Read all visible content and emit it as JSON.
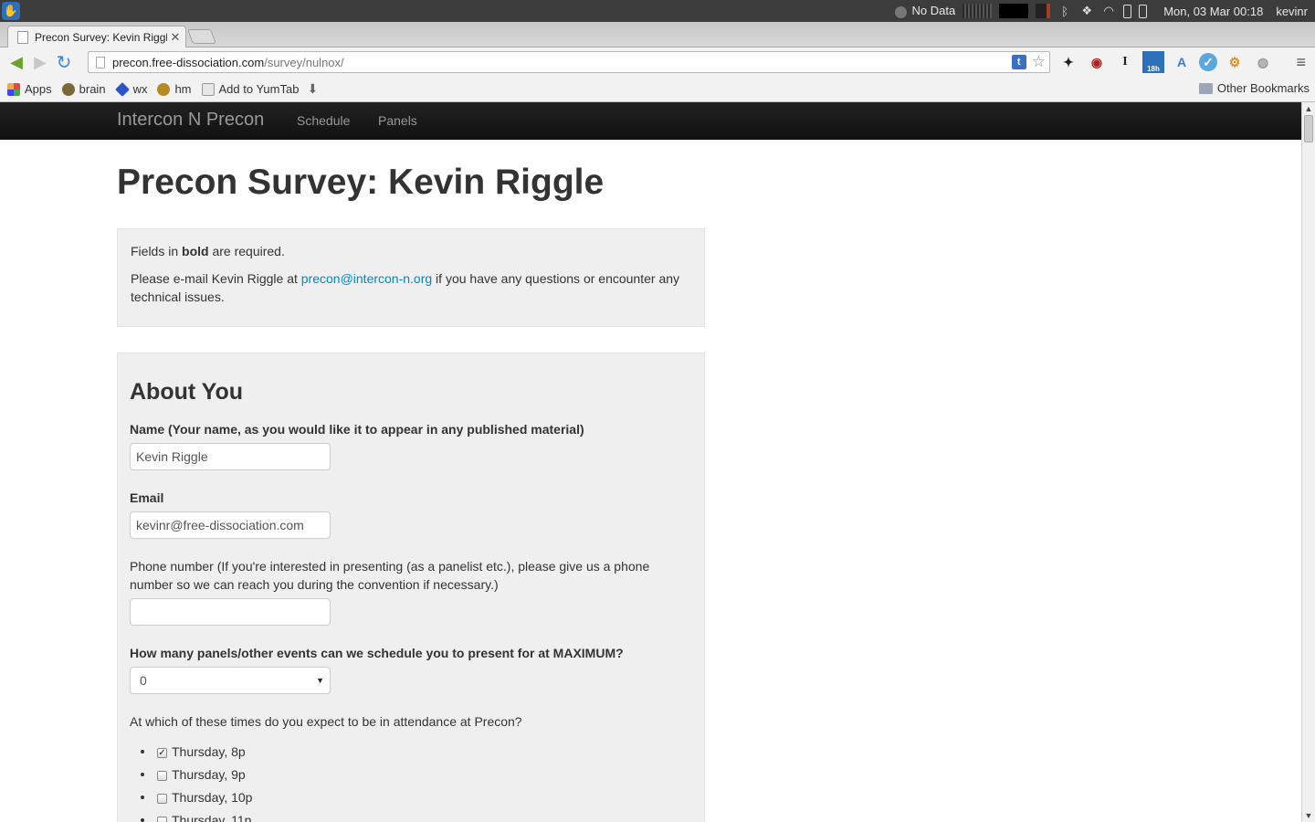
{
  "os_panel": {
    "status": "No Data",
    "datetime": "Mon, 03 Mar  00:18",
    "user": "kevinr"
  },
  "browser": {
    "tab_title": "Precon Survey: Kevin Riggl",
    "url_host": "precon.free-dissociation.com",
    "url_path": "/survey/nulnox/",
    "ext_badge": "18h",
    "bookmarks": [
      "Apps",
      "brain",
      "wx",
      "hm",
      "Add to YumTab"
    ],
    "other_bookmarks": "Other Bookmarks"
  },
  "site": {
    "brand": "Intercon N Precon",
    "nav": [
      "Schedule",
      "Panels"
    ]
  },
  "page": {
    "title": "Precon Survey: Kevin Riggle",
    "notice": {
      "fields_prefix": "Fields in ",
      "fields_bold": "bold",
      "fields_suffix": " are required.",
      "email_prefix": "Please e-mail Kevin Riggle at ",
      "email_link": "precon@intercon-n.org",
      "email_suffix": " if you have any questions or encounter any technical issues."
    },
    "section": "About You",
    "fields": {
      "name_label": "Name (Your name, as you would like it to appear in any published material)",
      "name_value": "Kevin Riggle",
      "email_label": "Email",
      "email_value": "kevinr@free-dissociation.com",
      "phone_label": "Phone number (If you're interested in presenting (as a panelist etc.), please give us a phone number so we can reach you during the convention if necessary.)",
      "phone_value": "",
      "max_label": "How many panels/other events can we schedule you to present for at MAXIMUM?",
      "max_value": "0",
      "attendance_label": "At which of these times do you expect to be in attendance at Precon?"
    },
    "attendance": [
      {
        "label": "Thursday, 8p",
        "checked": true
      },
      {
        "label": "Thursday, 9p",
        "checked": false
      },
      {
        "label": "Thursday, 10p",
        "checked": false
      },
      {
        "label": "Thursday, 11p",
        "checked": false
      }
    ]
  }
}
